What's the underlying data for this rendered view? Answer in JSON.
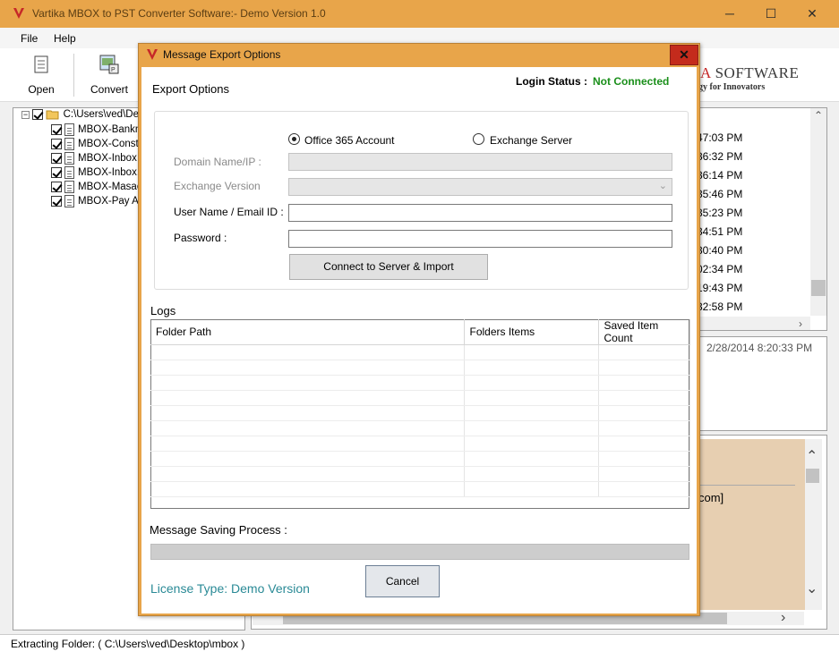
{
  "window": {
    "title": "Vartika MBOX to PST Converter Software:- Demo Version 1.0",
    "minimize": "─",
    "maximize": "☐",
    "close": "✕"
  },
  "menu": {
    "file": "File",
    "help": "Help"
  },
  "toolbar": {
    "open": "Open",
    "convert": "Convert"
  },
  "brand": {
    "name_part": "A",
    "name_rest": " SOFTWARE",
    "tagline": "gy for Innovators"
  },
  "tree": {
    "root": "C:\\Users\\ved\\De",
    "items": [
      "MBOX-Bankn",
      "MBOX-Constr",
      "MBOX-Inbox",
      "MBOX-Inbox.",
      "MBOX-Masac",
      "MBOX-Pay Ap"
    ]
  },
  "list": {
    "times": [
      "47:03 PM",
      "36:32 PM",
      "36:14 PM",
      "35:46 PM",
      "35:23 PM",
      "34:51 PM",
      "30:40 PM",
      "02:34 PM",
      "19:43 PM",
      "32:58 PM"
    ]
  },
  "preview": {
    "date": "2/28/2014 8:20:33 PM",
    "email_fragment": "com]"
  },
  "status": {
    "text": "Extracting Folder: ( C:\\Users\\ved\\Desktop\\mbox )"
  },
  "dialog": {
    "title": "Message Export Options",
    "close": "✕",
    "section_title": "Export Options",
    "login_label": "Login Status :",
    "login_value": "Not Connected",
    "login_color": "#1a8f1a",
    "radio_office": "Office 365 Account",
    "radio_exchange": "Exchange Server",
    "selected_option": "Office 365 Account",
    "domain_label": "Domain Name/IP :",
    "exchange_version_label": "Exchange Version",
    "user_label": "User Name / Email ID :",
    "password_label": "Password :",
    "domain_value": "",
    "exchange_version_value": "",
    "user_value": "",
    "password_value": "",
    "connect_button": "Connect to Server & Import",
    "logs_label": "Logs",
    "logs_columns": [
      "Folder Path",
      "Folders Items",
      "Saved Item Count"
    ],
    "saving_label": "Message Saving Process :",
    "progress": 0,
    "cancel_button": "Cancel",
    "license": "License Type: Demo Version",
    "license_color": "#2a8a96"
  }
}
